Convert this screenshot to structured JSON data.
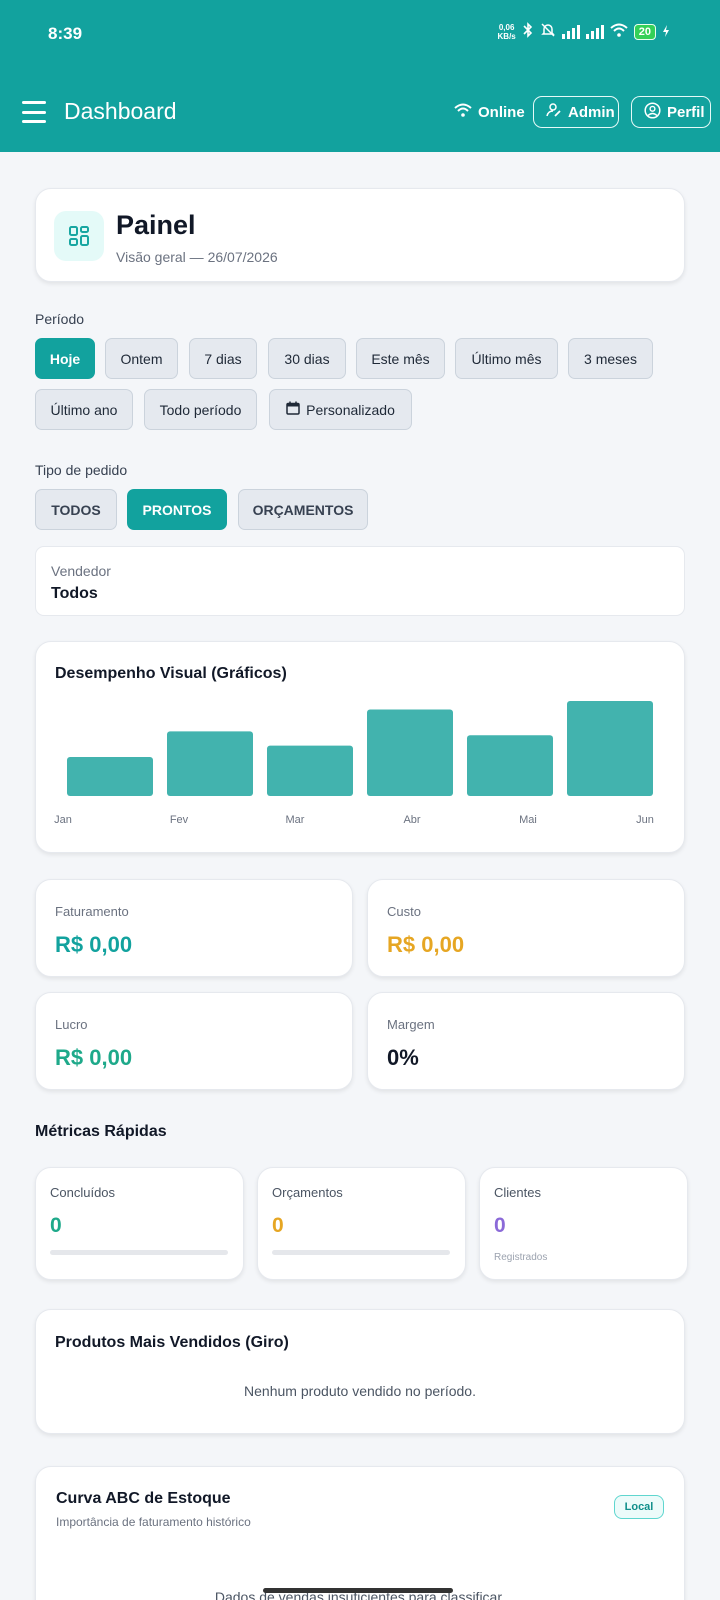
{
  "status_bar": {
    "time": "8:39",
    "net_speed_value": "0,06",
    "net_speed_unit": "KB/s",
    "battery": "20"
  },
  "header": {
    "title": "Dashboard",
    "online_label": "Online",
    "admin_label": "Admin",
    "perfil_label": "Perfil"
  },
  "painel": {
    "title": "Painel",
    "subtitle": "Visão geral — 26/07/2026",
    "icon": "dashboard-grid-icon"
  },
  "periodo": {
    "label": "Período",
    "options": [
      "Hoje",
      "Ontem",
      "7 dias",
      "30 dias",
      "Este mês",
      "Último mês",
      "3 meses",
      "Último ano",
      "Todo período",
      "Personalizado"
    ],
    "selected": "Hoje"
  },
  "tipo_pedido": {
    "label": "Tipo de pedido",
    "options": [
      "TODOS",
      "PRONTOS",
      "ORÇAMENTOS"
    ],
    "selected": "PRONTOS"
  },
  "vendedor": {
    "label": "Vendedor",
    "value": "Todos"
  },
  "chart_data": {
    "type": "bar",
    "title": "Desempenho Visual (Gráficos)",
    "categories": [
      "Jan",
      "Fev",
      "Mar",
      "Abr",
      "Mai",
      "Jun"
    ],
    "values": [
      0.41,
      0.68,
      0.53,
      0.91,
      0.64,
      1.0
    ],
    "color": "#42b3ae",
    "grid": false
  },
  "kpis": {
    "faturamento": {
      "label": "Faturamento",
      "value": "R$ 0,00",
      "color": "#12a29e"
    },
    "custo": {
      "label": "Custo",
      "value": "R$ 0,00",
      "color": "#e6a623"
    },
    "lucro": {
      "label": "Lucro",
      "value": "R$ 0,00",
      "color": "#1ea98a"
    },
    "margem": {
      "label": "Margem",
      "value": "0%",
      "color": "#111827"
    }
  },
  "metricas": {
    "title": "Métricas Rápidas",
    "concluidos": {
      "label": "Concluídos",
      "value": "0",
      "color": "#1ea98a",
      "progress": 0
    },
    "orcamentos": {
      "label": "Orçamentos",
      "value": "0",
      "color": "#e6a623",
      "progress": 0
    },
    "clientes": {
      "label": "Clientes",
      "value": "0",
      "note": "Registrados",
      "color": "#8b6ad8"
    }
  },
  "produtos": {
    "title": "Produtos Mais Vendidos (Giro)",
    "empty": "Nenhum produto vendido no período."
  },
  "curva_abc": {
    "title": "Curva ABC de Estoque",
    "subtitle": "Importância de faturamento histórico",
    "badge": "Local",
    "empty": "Dados de vendas insuficientes para classificar."
  },
  "colors": {
    "primary": "#12a29e",
    "background": "#f4f6f9"
  }
}
